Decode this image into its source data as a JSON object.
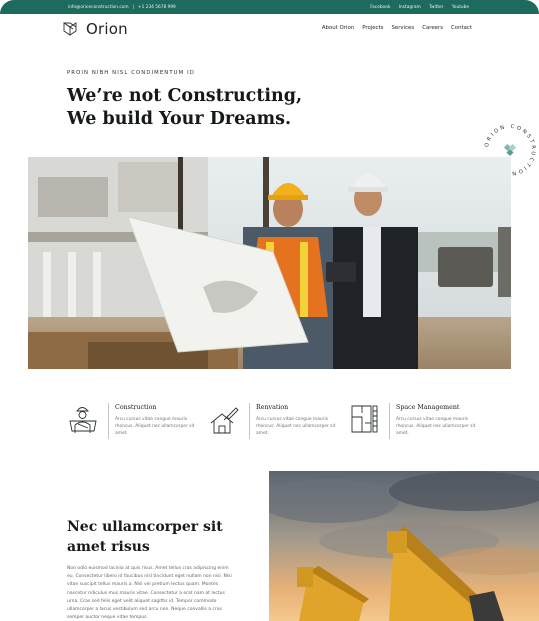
{
  "topbar": {
    "email": "info@orionconstruction.com",
    "separator": "|",
    "phone": "+1 234 5678 999",
    "social": [
      "Facebook",
      "Instagram",
      "Twitter",
      "Youtube"
    ]
  },
  "brand": {
    "name": "Orion",
    "icon": "orion-logo-icon"
  },
  "nav": {
    "items": [
      "About Orion",
      "Projects",
      "Services",
      "Careers",
      "Contact"
    ]
  },
  "hero": {
    "eyebrow": "PROIN NIBH NISL CONDIMENTUM ID",
    "title": "We’re not Constructing, We build Your Dreams.",
    "badge_text": "ORION CONSTRUCTION"
  },
  "services": [
    {
      "title": "Construction",
      "desc": "Arcu cursus vitae congue mauris rhoncus. Aliquet nec ullamcorper sit amet.",
      "icon": "worker-blueprint-icon"
    },
    {
      "title": "Renvation",
      "desc": "Arcu cursus vitae congue mauris rhoncus. Aliquet nec ullamcorper sit amet.",
      "icon": "house-paintbrush-icon"
    },
    {
      "title": "Space Management",
      "desc": "Arcu cursus vitae congue mauris rhoncus. Aliquet nec ullamcorper sit amet.",
      "icon": "floorplan-icon"
    }
  ],
  "about": {
    "title": "Nec ullamcorper sit amet risus",
    "body": "Non odio euismod lacinia at quis risus. Amet tellus cras adipiscing enim eu. Consectetur libero id faucibus nisl tincidunt eget nullam non nisi. Nisi vitae suscipit tellus mauris a. Nisl vel pretium lectus quam. Montes nascetur ridiculus mus mauris vitae. Consectetur a erat nam at lectus urna. Cras sed felis eget velit aliquet sagittis id. Tempor commodo ullamcorper a lacus vestibulum sed arcu non. Neque convallis a cras semper auctor neque vitae tempus."
  },
  "colors": {
    "accent": "#1c6b5e",
    "text": "#15191b",
    "muted": "#6b7375"
  }
}
